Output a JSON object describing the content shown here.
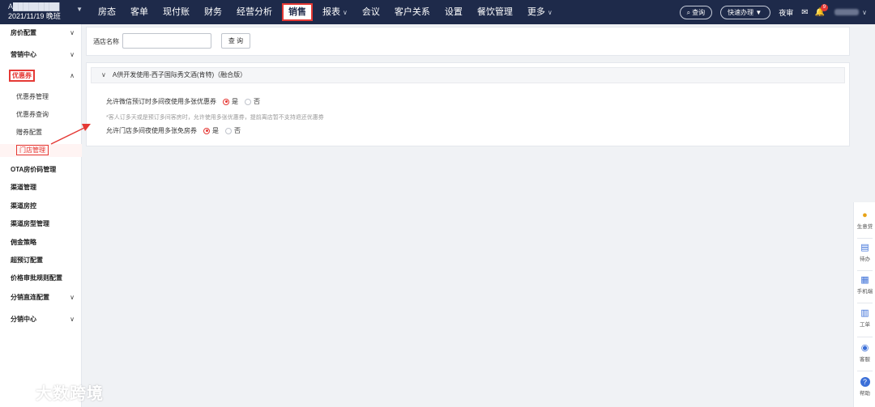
{
  "header": {
    "hotel_name": "A█████████",
    "date_shift": "2021/11/19 晚班",
    "nav": [
      {
        "label": "房态",
        "dropdown": false
      },
      {
        "label": "客单",
        "dropdown": false
      },
      {
        "label": "现付账",
        "dropdown": false
      },
      {
        "label": "财务",
        "dropdown": false
      },
      {
        "label": "经营分析",
        "dropdown": false
      },
      {
        "label": "销售",
        "dropdown": false,
        "active": true
      },
      {
        "label": "报表",
        "dropdown": true
      },
      {
        "label": "会议",
        "dropdown": false
      },
      {
        "label": "客户关系",
        "dropdown": false
      },
      {
        "label": "设置",
        "dropdown": false
      },
      {
        "label": "餐饮管理",
        "dropdown": false
      },
      {
        "label": "更多",
        "dropdown": true
      }
    ],
    "search_pill": "查询",
    "quick_pill": "快速办理",
    "night_audit": "夜审",
    "notification_count": "9"
  },
  "sidebar": {
    "items": [
      {
        "label": "房价配置",
        "chevron": "down"
      },
      {
        "label": "营销中心",
        "chevron": "down"
      },
      {
        "label": "优惠券",
        "chevron": "up"
      },
      {
        "label": "OTA房价码管理"
      },
      {
        "label": "渠道管理"
      },
      {
        "label": "渠道房控"
      },
      {
        "label": "渠道房型管理"
      },
      {
        "label": "佣金策略"
      },
      {
        "label": "超预订配置"
      },
      {
        "label": "价格审批规则配置"
      },
      {
        "label": "分销直连配置",
        "chevron": "down"
      },
      {
        "label": "分销中心",
        "chevron": "down"
      }
    ],
    "coupon_subitems": [
      "优惠券管理",
      "优惠券查询",
      "赠券配置",
      "门店管理"
    ]
  },
  "search": {
    "label": "酒店名称",
    "value": "",
    "placeholder": "",
    "button": "查 询"
  },
  "panel": {
    "title": "A供开发使用-西子国际秀文酒(肯特)（融合版）",
    "option1_label": "允许微信预订时多间夜使用多张优惠券",
    "option1_yes": "是",
    "option1_no": "否",
    "option1_value": "是",
    "hint": "*客人订多天或是预订多间客房时，允许使用多张优惠券，提前离店暂不支持退还优惠券",
    "option2_label": "允许门店多间夜使用多张免房券",
    "option2_yes": "是",
    "option2_no": "否",
    "option2_value": "是"
  },
  "rail": [
    {
      "label": "生意贷",
      "icon": "ingot-icon"
    },
    {
      "label": "待办",
      "icon": "todo-icon"
    },
    {
      "label": "手机端",
      "icon": "qr-icon"
    },
    {
      "label": "工单",
      "icon": "ticket-icon"
    },
    {
      "label": "客服",
      "icon": "headset-icon"
    },
    {
      "label": "帮助",
      "icon": "help-icon"
    }
  ],
  "watermark": "大数跨境",
  "colors": {
    "topbar": "#1e2a4a",
    "accent_red": "#e53935",
    "rail_icon": "#3b6fd8"
  }
}
